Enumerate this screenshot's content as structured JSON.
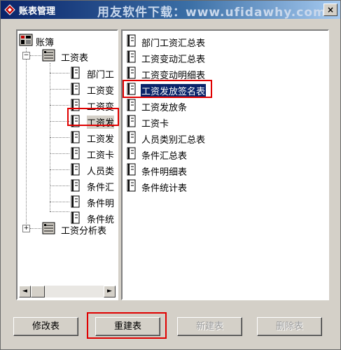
{
  "window": {
    "title": "账表管理",
    "watermark": "用友软件下载：www.ufidawhy.com",
    "close_glyph": "×"
  },
  "tree": {
    "root": {
      "label": "账簿"
    },
    "groups": [
      {
        "label": "工资表",
        "expanded": true,
        "expander": "−",
        "items": [
          "部门工",
          "工资变",
          "工资变",
          "工资发",
          "工资发",
          "工资卡",
          "人员类",
          "条件汇",
          "条件明",
          "条件统"
        ]
      },
      {
        "label": "工资分析表",
        "expanded": false,
        "expander": "+"
      }
    ],
    "highlighted_item_index": 3
  },
  "scrollbar": {
    "left_arrow": "◄",
    "right_arrow": "►"
  },
  "list": {
    "items": [
      "部门工资汇总表",
      "工资变动汇总表",
      "工资变动明细表",
      "工资发放签名表",
      "工资发放条",
      "工资卡",
      "人员类别汇总表",
      "条件汇总表",
      "条件明细表",
      "条件统计表"
    ],
    "selected_index": 3
  },
  "buttons": {
    "modify": "修改表",
    "rebuild": "重建表",
    "new": "新建表",
    "delete": "删除表"
  },
  "colors": {
    "highlight_box": "#e00000",
    "selection": "#0a246a",
    "title_bar": "#0a246a"
  }
}
